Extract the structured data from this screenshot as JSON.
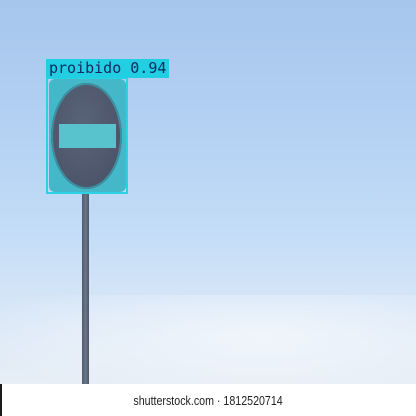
{
  "detection": {
    "label": "proibido 0.94",
    "box_color": "#2bd2e6"
  },
  "watermark": {
    "text": "shutterstock.com · 1812520714"
  },
  "scene": {
    "sky_color": "#b2d0f2",
    "sign_color": "#4c5569",
    "bar_color": "#59c3cd"
  }
}
